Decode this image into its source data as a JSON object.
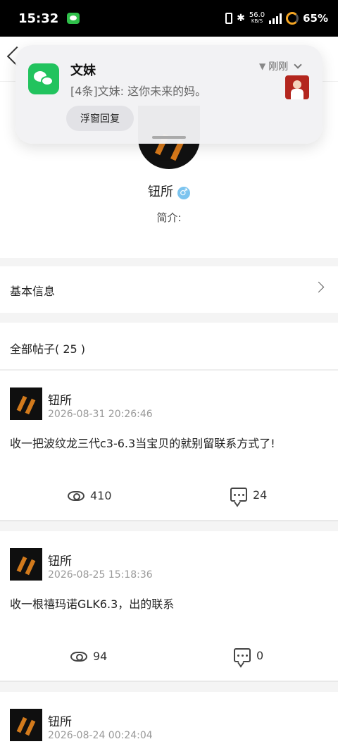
{
  "status_bar": {
    "time": "15:32",
    "net_speed": "56.0",
    "net_unit": "KB/S",
    "battery": "65%"
  },
  "notification": {
    "title": "文妹",
    "message": "[4条]文妹: 这你未来的妈。",
    "time": "刚刚",
    "reply_label": "浮窗回复"
  },
  "profile": {
    "name": "钮所",
    "intro_label": "简介:"
  },
  "sections": {
    "basic_info": "基本信息",
    "all_posts": "全部帖子( 25 )"
  },
  "posts": [
    {
      "author": "钮所",
      "time": "2026-08-31 20:26:46",
      "text": "收一把波纹龙三代c3-6.3当宝贝的就别留联系方式了!",
      "views": "410",
      "comments": "24"
    },
    {
      "author": "钮所",
      "time": "2026-08-25 15:18:36",
      "text": "收一根禧玛诺GLK6.3，出的联系",
      "views": "94",
      "comments": "0"
    },
    {
      "author": "钮所",
      "time": "2026-08-24 00:24:04"
    }
  ]
}
